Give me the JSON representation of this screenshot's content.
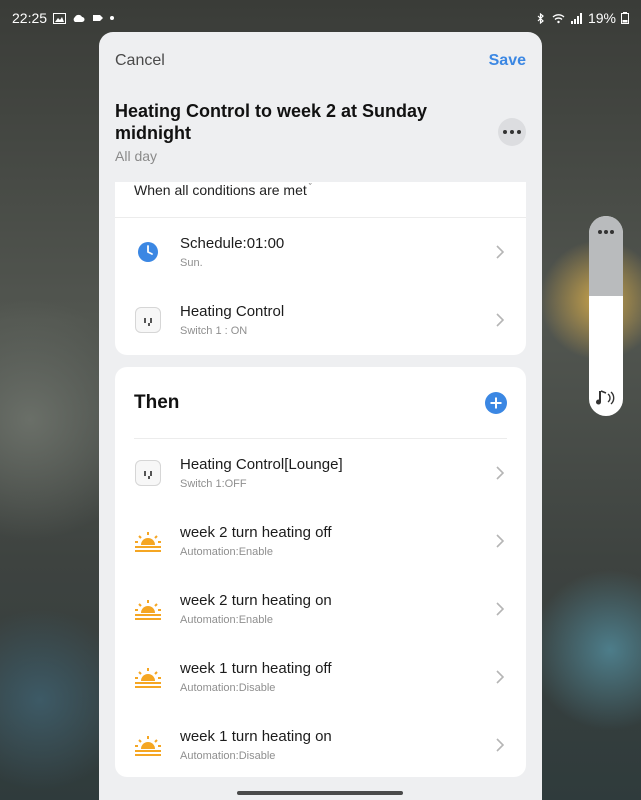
{
  "status_bar": {
    "time": "22:25",
    "battery": "19%"
  },
  "header": {
    "cancel_label": "Cancel",
    "save_label": "Save"
  },
  "automation": {
    "title": "Heating Control to week 2 at Sunday midnight",
    "subtitle": "All day"
  },
  "conditions": {
    "header": "When all conditions are met",
    "items": [
      {
        "title": "Schedule:01:00",
        "subtitle": "Sun.",
        "icon": "clock-icon"
      },
      {
        "title": "Heating Control",
        "subtitle": "Switch 1 : ON",
        "icon": "socket-icon"
      }
    ]
  },
  "then": {
    "title": "Then",
    "items": [
      {
        "title": "Heating Control[Lounge]",
        "subtitle": "Switch 1:OFF",
        "icon": "socket-icon"
      },
      {
        "title": "week 2 turn heating off",
        "subtitle": "Automation:Enable",
        "icon": "sunrise-icon"
      },
      {
        "title": "week 2 turn heating on",
        "subtitle": "Automation:Enable",
        "icon": "sunrise-icon"
      },
      {
        "title": "week 1 turn heating off",
        "subtitle": "Automation:Disable",
        "icon": "sunrise-icon"
      },
      {
        "title": "week 1 turn heating on",
        "subtitle": "Automation:Disable",
        "icon": "sunrise-icon"
      }
    ]
  },
  "colors": {
    "accent": "#3b87e3",
    "sunrise": "#f5a623",
    "sheet_bg": "#eeeff1"
  }
}
